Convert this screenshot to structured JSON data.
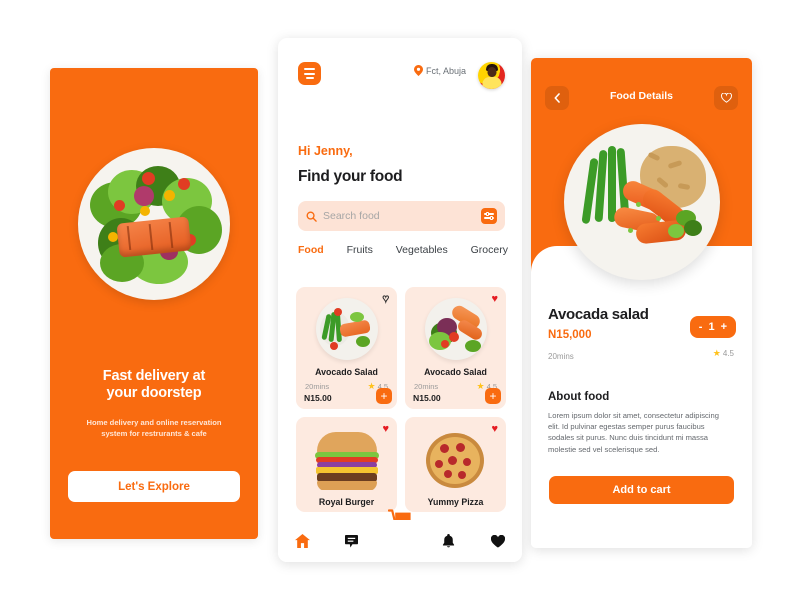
{
  "theme": {
    "orange": "#F96B10",
    "card_peach": "#FDEAE0",
    "search_peach": "#FDE3D6",
    "heart_red": "#E51C23",
    "star_yellow": "#FFC21C"
  },
  "onboarding": {
    "title_line1": "Fast delivery at",
    "title_line2": "your doorstep",
    "subtitle_line1": "Home delivery and online reservation",
    "subtitle_line2": "system for restrurants & cafe",
    "cta_label": "Let's Explore",
    "hero_image_alt": "salmon-salad-plate"
  },
  "home": {
    "menu_icon": "hamburger-icon",
    "location": "Fct, Abuja",
    "location_icon": "map-pin-icon",
    "avatar_alt": "user-avatar",
    "greeting": "Hi Jenny,",
    "headline": "Find your food",
    "search": {
      "placeholder": "Search food",
      "value": "",
      "search_icon": "search-icon",
      "filter_icon": "filter-sliders-icon"
    },
    "tabs": [
      {
        "label": "Food",
        "active": true
      },
      {
        "label": "Fruits",
        "active": false
      },
      {
        "label": "Vegetables",
        "active": false
      },
      {
        "label": "Grocery",
        "active": false
      }
    ],
    "cards": [
      {
        "title": "Avocado Salad",
        "time": "20mins",
        "rating": "4.5",
        "price": "N15.00",
        "favorited": false,
        "add_label": "+",
        "image_alt": "salmon-green-beans-salad"
      },
      {
        "title": "Avocado Salad",
        "time": "20mins",
        "rating": "4.5",
        "price": "N15.00",
        "favorited": true,
        "add_label": "+",
        "image_alt": "salmon-mixed-salad"
      },
      {
        "title": "Royal Burger",
        "time": "",
        "rating": "",
        "price": "",
        "favorited": true,
        "add_label": "+",
        "image_alt": "cheeseburger"
      },
      {
        "title": "Yummy Pizza",
        "time": "",
        "rating": "",
        "price": "",
        "favorited": true,
        "add_label": "+",
        "image_alt": "pepperoni-pizza"
      }
    ],
    "bottom_nav": [
      {
        "icon": "home-icon",
        "glyph": "⌂",
        "active": true
      },
      {
        "icon": "chat-icon",
        "glyph": "⬛",
        "active": false
      },
      {
        "icon": "cart-icon",
        "glyph": "🛒",
        "active": true
      },
      {
        "icon": "bell-icon",
        "glyph": "🔔",
        "active": false
      },
      {
        "icon": "heart-icon",
        "glyph": "♥",
        "active": false
      }
    ]
  },
  "details": {
    "header_title": "Food Details",
    "back_icon": "chevron-left-icon",
    "favorite_icon": "heart-outline-icon",
    "image_alt": "chicken-rice-green-beans-plate",
    "name": "Avocada salad",
    "price": "N15,000",
    "time": "20mins",
    "rating": "4.5",
    "stepper": {
      "minus": "-",
      "quantity": "1",
      "plus": "+"
    },
    "about_title": "About  food",
    "about_body": "Lorem ipsum dolor sit amet, consectetur adipiscing elit. Id pulvinar egestas semper purus faucibus sodales sit purus. Nunc duis tincidunt mi massa molestie sed vel scelerisque sed.",
    "cta_label": "Add to cart"
  }
}
